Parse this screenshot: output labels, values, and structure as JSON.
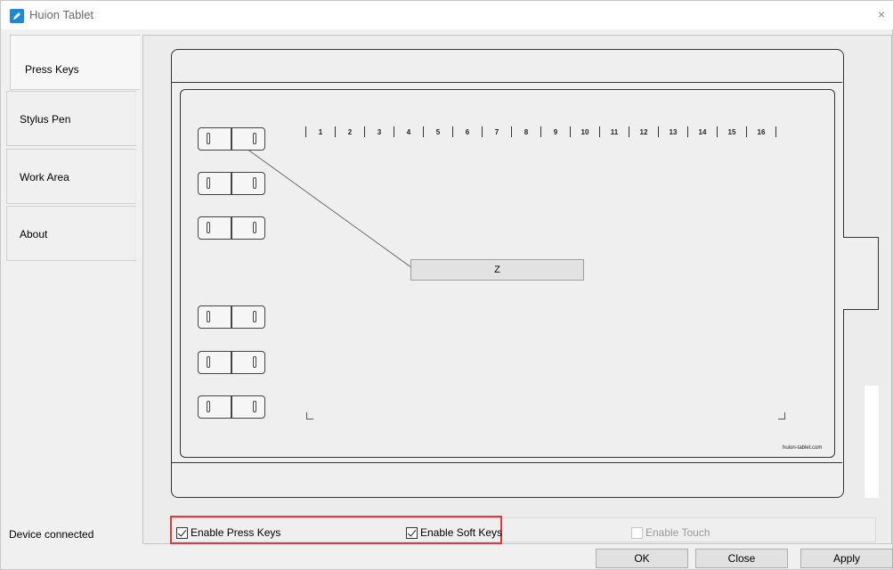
{
  "window": {
    "title": "Huion Tablet",
    "close_glyph": "×"
  },
  "sidebar": {
    "tabs": [
      {
        "label": "Press Keys",
        "active": true
      },
      {
        "label": "Stylus Pen",
        "active": false
      },
      {
        "label": "Work Area",
        "active": false
      },
      {
        "label": "About",
        "active": false
      }
    ]
  },
  "tablet": {
    "soft_key_numbers": [
      "1",
      "2",
      "3",
      "4",
      "5",
      "6",
      "7",
      "8",
      "9",
      "10",
      "11",
      "12",
      "13",
      "14",
      "15",
      "16"
    ],
    "assigned_key_label": "Z",
    "brand": "huion-tablet.com"
  },
  "options": {
    "enable_press_keys": {
      "label": "Enable Press Keys",
      "checked": true
    },
    "enable_soft_keys": {
      "label": "Enable Soft Keys",
      "checked": true
    },
    "enable_touch": {
      "label": "Enable Touch",
      "checked": false,
      "disabled": true
    }
  },
  "status": {
    "text": "Device connected"
  },
  "buttons": {
    "ok": "OK",
    "close": "Close",
    "apply": "Apply"
  },
  "colors": {
    "highlight": "#e03a3a",
    "accent": "#1e88d8"
  }
}
